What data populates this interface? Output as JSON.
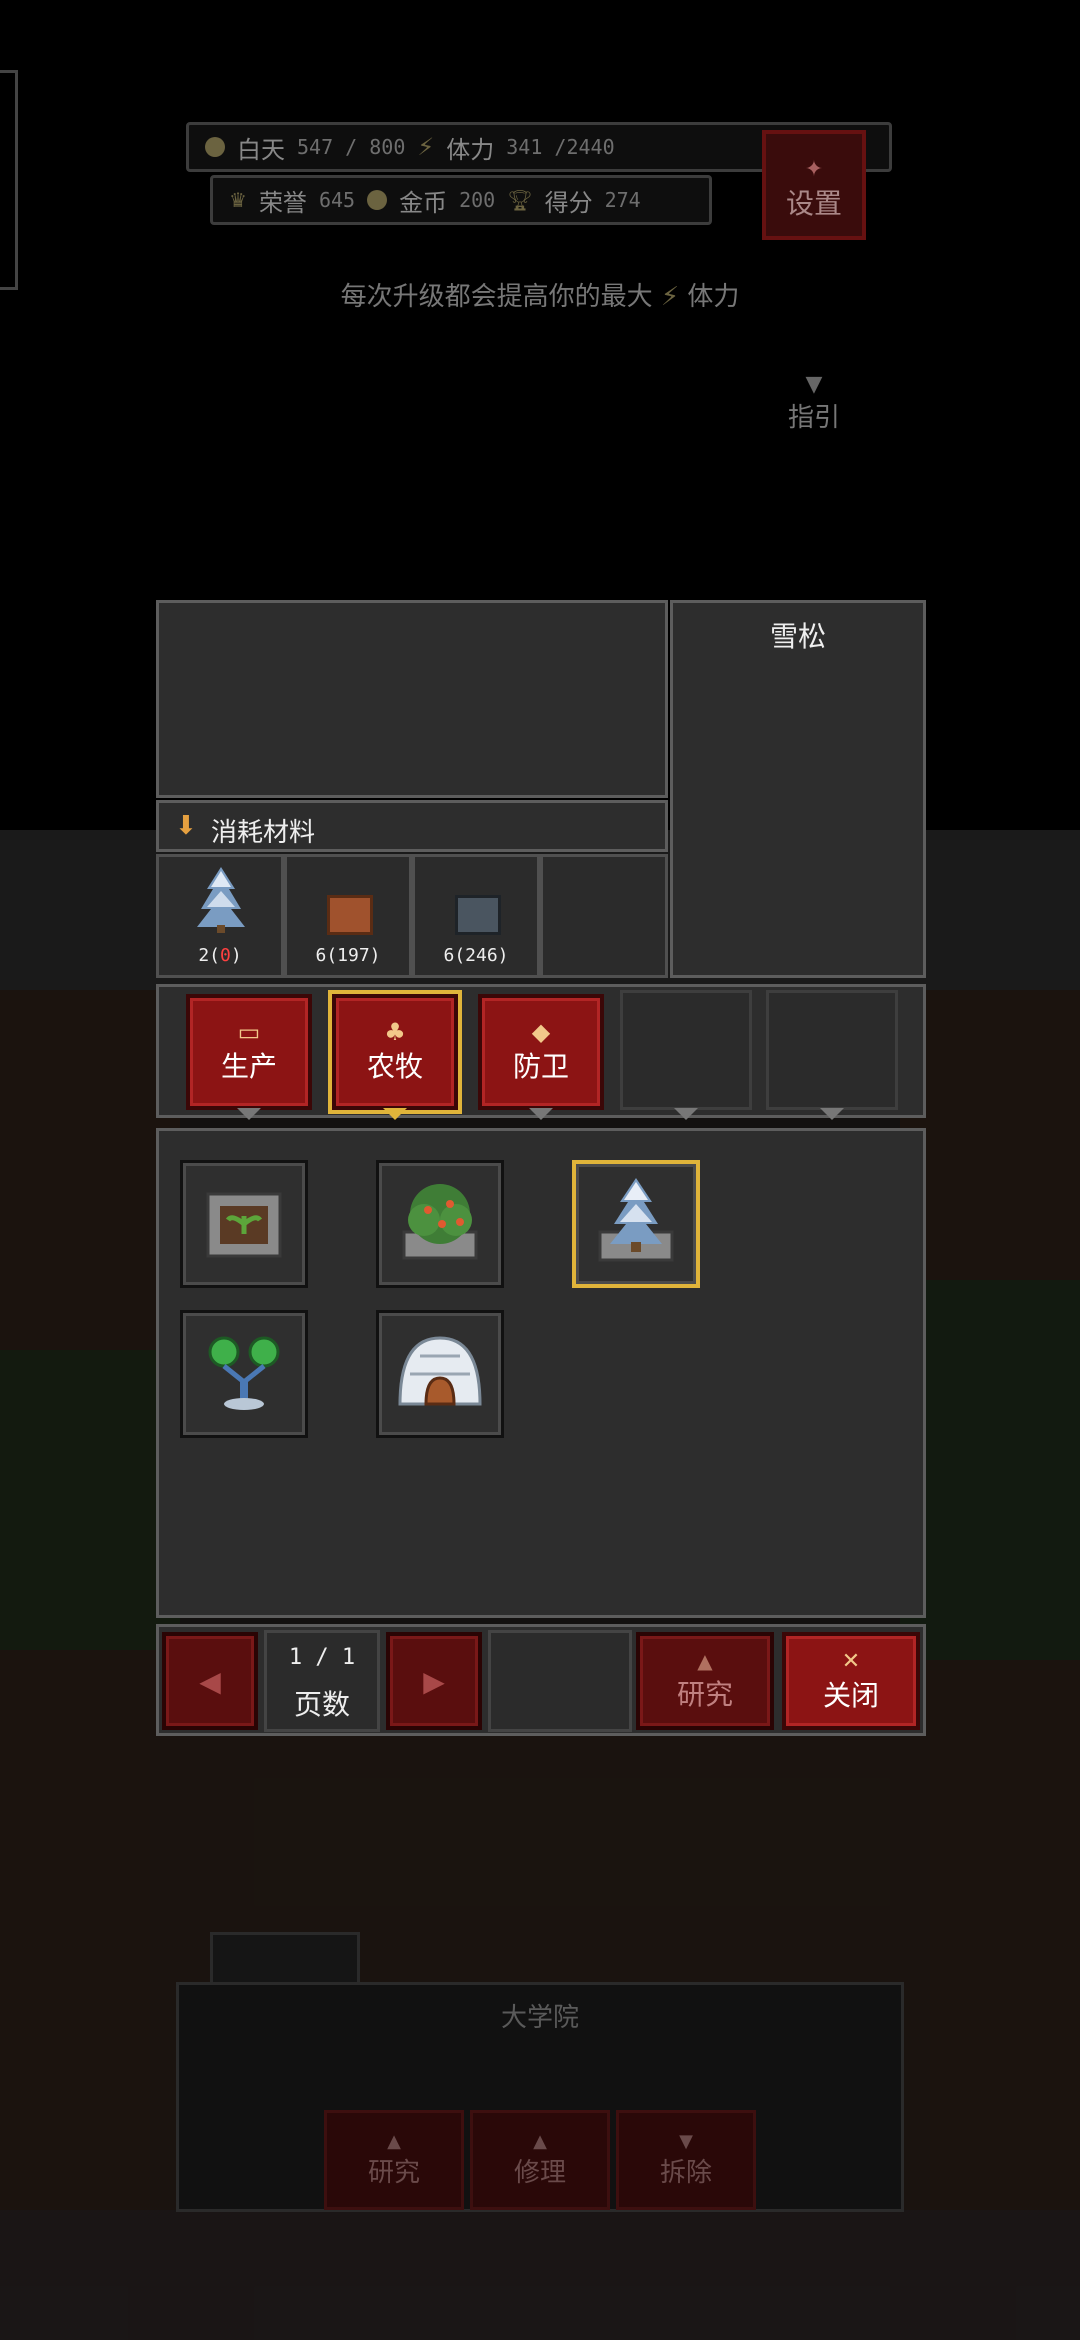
{
  "hud": {
    "day_label": "白天",
    "day_value": "547 / 800",
    "stamina_label": "体力",
    "stamina_value": "341 /2440",
    "honor_label": "荣誉",
    "honor_value": "645",
    "gold_label": "金币",
    "gold_value": "200",
    "score_label": "得分",
    "score_value": "274",
    "settings_label": "设置"
  },
  "hint": {
    "text_prefix": "每次升级都会提高你的最大",
    "text_suffix": "体力"
  },
  "guide_label": "指引",
  "detail": {
    "name": "雪松",
    "materials_header": "消耗材料",
    "materials": [
      {
        "icon": "snow-pine-icon",
        "count": "2",
        "owned": "0"
      },
      {
        "icon": "brick-icon",
        "count": "6",
        "owned": "197"
      },
      {
        "icon": "stone-block-icon",
        "count": "6",
        "owned": "246"
      }
    ]
  },
  "tabs": [
    {
      "label": "生产",
      "icon": "anvil-icon"
    },
    {
      "label": "农牧",
      "icon": "sprout-icon"
    },
    {
      "label": "防卫",
      "icon": "shield-icon"
    }
  ],
  "items": [
    {
      "name": "seedling-planter-item"
    },
    {
      "name": "berry-bush-item"
    },
    {
      "name": "snow-pine-item"
    },
    {
      "name": "twin-lamp-item"
    },
    {
      "name": "igloo-item"
    }
  ],
  "pager": {
    "page_value": "1 / 1",
    "page_label": "页数",
    "research_label": "研究",
    "close_label": "关闭"
  },
  "background_panel": {
    "title": "大学院",
    "research_label": "研究",
    "repair_label": "修理",
    "demolish_label": "拆除"
  },
  "colors": {
    "accent_red": "#8c1414",
    "selection_gold": "#e0b43a",
    "panel_gray": "#2d2d2d"
  }
}
